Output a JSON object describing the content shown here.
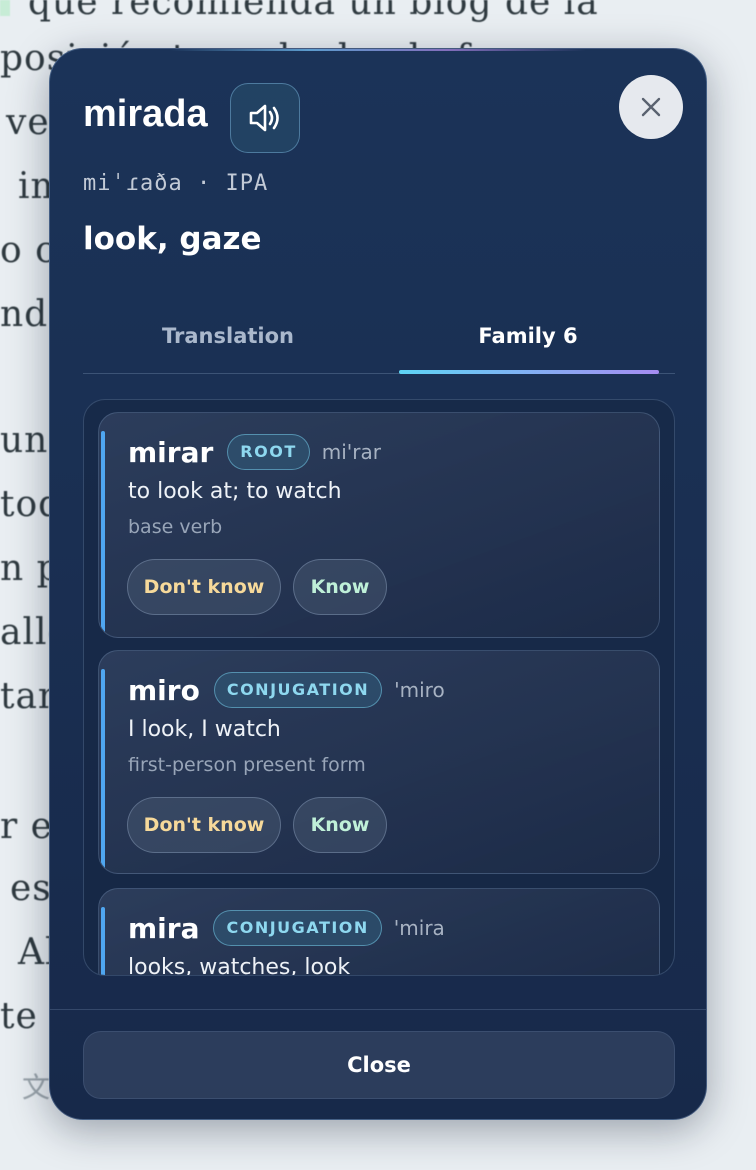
{
  "background": {
    "lines": [
      "qué recomienda un blog de la",
      "posición tomada donde fuera",
      "ve",
      "im",
      "o c",
      "ndo",
      "un r",
      "toq",
      "n p",
      "alle",
      "tam",
      "r e",
      "es",
      "Al",
      "te"
    ],
    "translate_icon": "translate-icon"
  },
  "modal": {
    "word": "mirada",
    "ipa": "miˈɾaða · IPA",
    "gloss": "look, gaze",
    "audio_icon": "speaker-icon",
    "close_icon": "close-icon",
    "tabs": {
      "translation": "Translation",
      "family": "Family 6",
      "active": "family"
    },
    "family": [
      {
        "word": "mirar",
        "badge": "ROOT",
        "ipa": "mi'rar",
        "meaning": "to look at; to watch",
        "note": "base verb",
        "dont_know": "Don't know",
        "know": "Know"
      },
      {
        "word": "miro",
        "badge": "CONJUGATION",
        "ipa": "'miro",
        "meaning": "I look, I watch",
        "note": "first-person present form",
        "dont_know": "Don't know",
        "know": "Know"
      },
      {
        "word": "mira",
        "badge": "CONJUGATION",
        "ipa": "'mira",
        "meaning": "looks, watches, look"
      }
    ],
    "close_label": "Close"
  },
  "colors": {
    "modal_bg": "#1a2f52",
    "accent_bar": "#4fa6f0",
    "tab_gradient_start": "#5ed4f5",
    "tab_gradient_end": "#a58cf2",
    "dont_know_text": "#f6d99a",
    "know_text": "#bff0d8",
    "badge_text": "#8ed8ef"
  }
}
